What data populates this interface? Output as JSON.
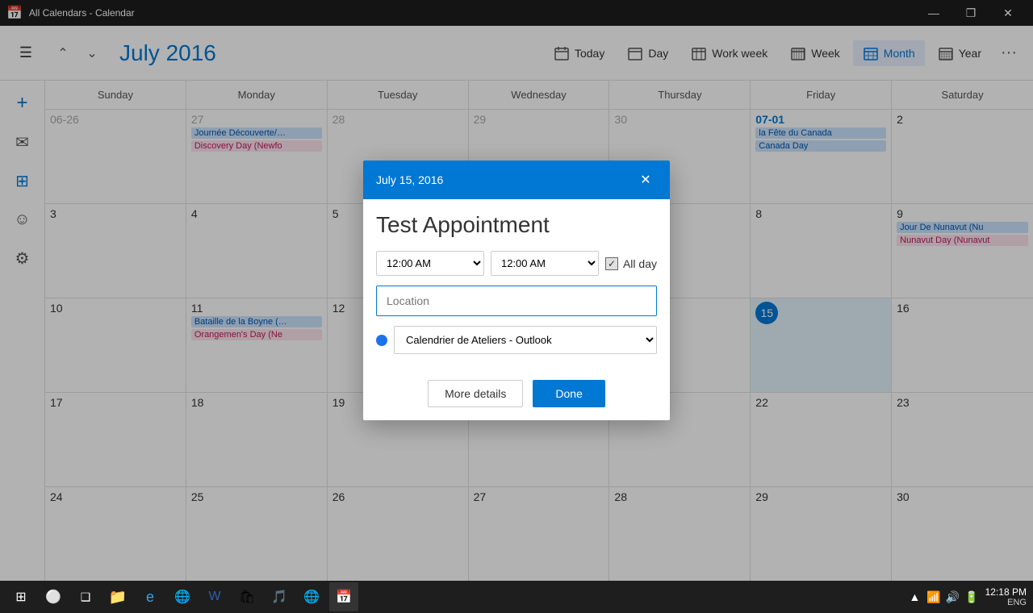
{
  "titleBar": {
    "title": "All Calendars - Calendar",
    "minimize": "—",
    "maximize": "❐",
    "close": "✕"
  },
  "toolbar": {
    "hamburger": "☰",
    "prevLabel": "‹",
    "nextLabel": "›",
    "monthTitle": "July 2016",
    "views": [
      {
        "id": "today",
        "label": "Today",
        "icon": "today"
      },
      {
        "id": "day",
        "label": "Day",
        "icon": "day"
      },
      {
        "id": "workweek",
        "label": "Work week",
        "icon": "workweek"
      },
      {
        "id": "week",
        "label": "Week",
        "icon": "week"
      },
      {
        "id": "month",
        "label": "Month",
        "icon": "month",
        "active": true
      },
      {
        "id": "year",
        "label": "Year",
        "icon": "year"
      }
    ]
  },
  "sidebar": {
    "addIcon": "+",
    "navItems": [
      {
        "id": "mail",
        "icon": "✉",
        "active": false
      },
      {
        "id": "calendar",
        "icon": "📅",
        "active": true
      },
      {
        "id": "people",
        "icon": "☺",
        "active": false
      },
      {
        "id": "settings",
        "icon": "⚙",
        "active": false
      }
    ]
  },
  "calendar": {
    "dayHeaders": [
      "Sunday",
      "Monday",
      "Tuesday",
      "Wednesday",
      "Thursday",
      "Friday",
      "Saturday"
    ],
    "weeks": [
      [
        {
          "num": "06-26",
          "otherMonth": true,
          "events": []
        },
        {
          "num": "27",
          "otherMonth": true,
          "events": [
            {
              "text": "Journée Découverte/…",
              "type": "blue"
            },
            {
              "text": "Discovery Day (Newfo",
              "type": "pink"
            }
          ]
        },
        {
          "num": "28",
          "otherMonth": true,
          "events": []
        },
        {
          "num": "29",
          "otherMonth": true,
          "events": []
        },
        {
          "num": "30",
          "otherMonth": true,
          "events": []
        },
        {
          "num": "07-01",
          "otherMonth": false,
          "today": false,
          "events": [
            {
              "text": "la Fête du Canada",
              "type": "blue"
            },
            {
              "text": "Canada Day",
              "type": "blue"
            }
          ]
        },
        {
          "num": "2",
          "otherMonth": false,
          "events": []
        }
      ],
      [
        {
          "num": "3",
          "events": []
        },
        {
          "num": "4",
          "events": []
        },
        {
          "num": "5",
          "events": []
        },
        {
          "num": "",
          "events": []
        },
        {
          "num": "",
          "events": []
        },
        {
          "num": "8",
          "events": []
        },
        {
          "num": "9",
          "events": [
            {
              "text": "Jour De Nunavut (Nu",
              "type": "blue"
            },
            {
              "text": "Nunavut Day (Nunavut",
              "type": "pink"
            }
          ]
        }
      ],
      [
        {
          "num": "10",
          "events": []
        },
        {
          "num": "11",
          "events": [
            {
              "text": "Bataille de la Boyne (…",
              "type": "blue"
            },
            {
              "text": "Orangemen's Day (Ne",
              "type": "pink"
            }
          ]
        },
        {
          "num": "12",
          "events": []
        },
        {
          "num": "",
          "events": []
        },
        {
          "num": "",
          "events": []
        },
        {
          "num": "15",
          "selected": true,
          "events": []
        },
        {
          "num": "16",
          "events": []
        }
      ],
      [
        {
          "num": "17",
          "events": []
        },
        {
          "num": "18",
          "events": []
        },
        {
          "num": "19",
          "events": []
        },
        {
          "num": "",
          "events": []
        },
        {
          "num": "",
          "events": []
        },
        {
          "num": "22",
          "events": []
        },
        {
          "num": "23",
          "events": []
        }
      ],
      [
        {
          "num": "24",
          "events": []
        },
        {
          "num": "25",
          "events": []
        },
        {
          "num": "26",
          "events": []
        },
        {
          "num": "27",
          "events": []
        },
        {
          "num": "28",
          "events": []
        },
        {
          "num": "29",
          "events": []
        },
        {
          "num": "30",
          "events": []
        }
      ]
    ]
  },
  "modal": {
    "headerDate": "July 15, 2016",
    "closeBtn": "✕",
    "appointmentTitle": "Test Appointment",
    "startTime": "12:00 AM",
    "endTime": "12:00 AM",
    "allDayLabel": "All day",
    "locationPlaceholder": "Location",
    "calendarOption": "Calendrier de Ateliers - Outlook",
    "moreDetailsLabel": "More details",
    "doneLabel": "Done"
  },
  "taskbar": {
    "time": "12:18 PM",
    "language": "ENG"
  }
}
